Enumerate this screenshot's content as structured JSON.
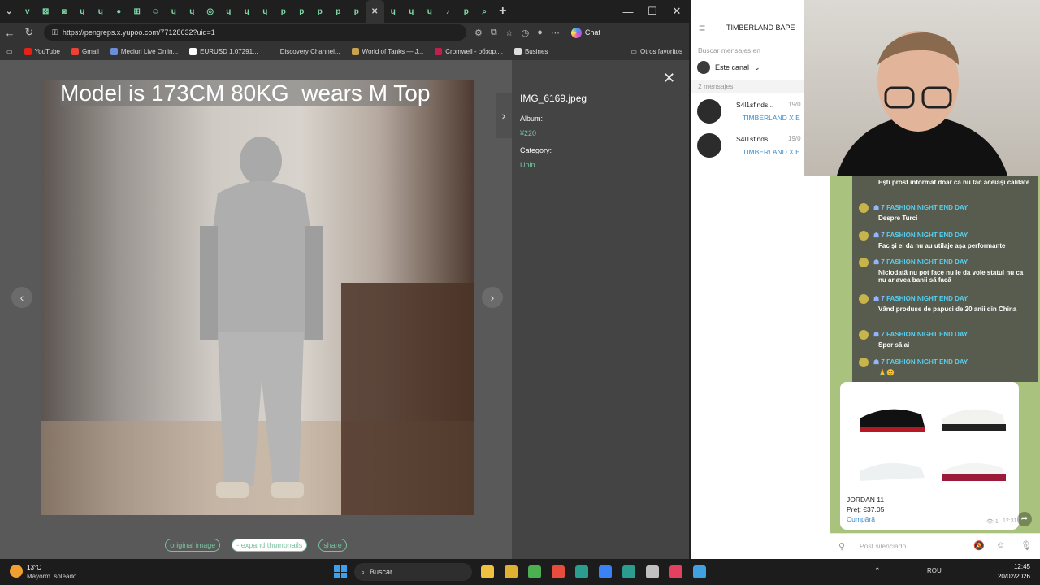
{
  "browser": {
    "tabs": [
      "v",
      "⊠",
      "◙",
      "ɥ",
      "ɥ",
      "●",
      "⊞",
      "☺",
      "ɥ",
      "ɥ",
      "◎",
      "ɥ",
      "ɥ",
      "ɥ",
      "p",
      "p",
      "p",
      "p",
      "p",
      "✕",
      "ɥ",
      "ɥ",
      "ɥ",
      "♪",
      "p",
      "⌕"
    ],
    "url": "https://pengreps.x.yupoo.com/77128632?uid=1",
    "chat_label": "Chat",
    "bookmarks": [
      {
        "label": "YouTube",
        "color": "#e62117"
      },
      {
        "label": "Gmail",
        "color": "#ea4335"
      },
      {
        "label": "Meciuri Live Onlin...",
        "color": "#6a8ed8"
      },
      {
        "label": "EURUSD 1,07291...",
        "color": "#ffffff"
      },
      {
        "label": "Discovery Channel...",
        "color": "#333333"
      },
      {
        "label": "World of Tanks — J...",
        "color": "#c9a34a"
      },
      {
        "label": "Cromwell - обзор,...",
        "color": "#c02050"
      },
      {
        "label": "Busines",
        "color": "#dddddd"
      }
    ],
    "other_bookmarks": "Otros favoritos"
  },
  "viewer": {
    "caption": "Model is 173CM 80KG  wears M Top",
    "filename": "IMG_6169.jpeg",
    "album_label": "Album:",
    "album_value": "¥220",
    "category_label": "Category:",
    "category_value": "Upin",
    "buttons": {
      "original": "original image",
      "expand": "- expand thumbnails",
      "share": "share"
    }
  },
  "telegram": {
    "search_query": "TIMBERLAND BAPE",
    "search_in": "Buscar mensajes en",
    "channel": "Este canal",
    "count": "2 mensajes",
    "results": [
      {
        "name": "S4l1sfinds...",
        "date": "19/0",
        "preview": "TIMBERLAND X E"
      },
      {
        "name": "S4l1sfinds...",
        "date": "19/0",
        "preview": "TIMBERLAND X E"
      }
    ],
    "post_title": "JORDAN 11",
    "post_price": "Preț: €37.05",
    "post_link": "Cumpără",
    "post_views": "1",
    "post_time": "12:31",
    "compose_placeholder": "Post silenciado..."
  },
  "overlay": {
    "name": "FASHION NIGHT END DAY",
    "badge": "7",
    "messages": [
      "Ești prost informat doar ca nu fac aceiași calitate",
      "Despre Turci",
      "Fac și ei da nu au utilaje așa performante",
      "Niciodată nu pot face nu le da voie statul nu ca nu ar avea banii să facă",
      "Vând produse de papuci de 20 anii din China",
      "Spor să ai",
      "🙏😊"
    ]
  },
  "taskbar": {
    "temp": "13°C",
    "weather": "Mayorm. soleado",
    "search": "Buscar",
    "lang": "ROU",
    "time": "12:45",
    "date": "20/02/2026"
  }
}
